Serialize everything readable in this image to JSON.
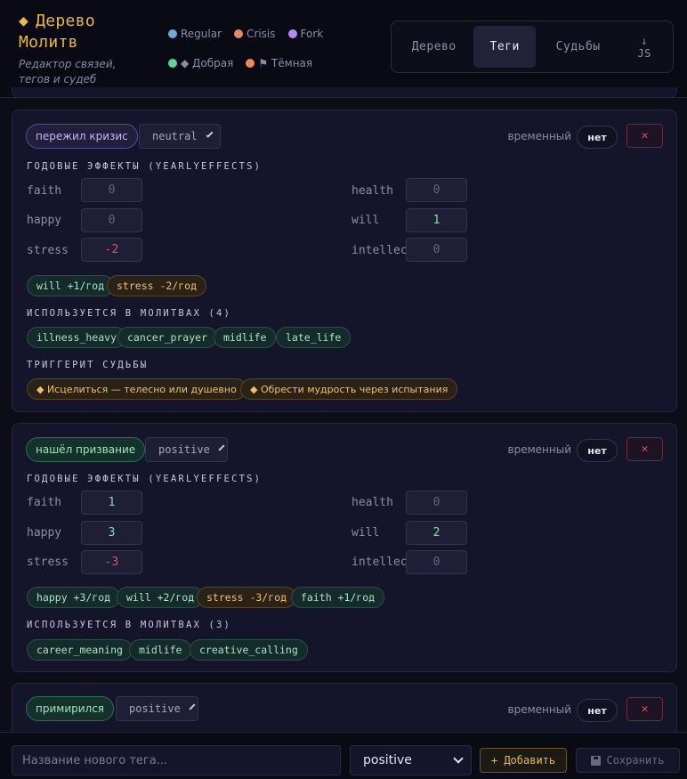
{
  "header": {
    "title_line1": "Дерево",
    "title_line2": "Молитв",
    "subtitle_line1": "Редактор связей,",
    "subtitle_line2": "тегов и судеб",
    "legend": [
      {
        "label": "Regular",
        "color": "#6fa8dc"
      },
      {
        "label": "Crisis",
        "color": "#e8856a"
      },
      {
        "label": "Fork",
        "color": "#b48cf0"
      },
      {
        "label": "◆ Добрая",
        "color": "#5fd49a"
      },
      {
        "label": "⚑ Тёмная",
        "color": "#f08a5d"
      }
    ],
    "tabs": [
      "Дерево",
      "Теги",
      "Судьбы"
    ],
    "active_tab": "Теги",
    "export_arrow": "↓",
    "export_label": "JS"
  },
  "cards": [
    {
      "tag": "пережил кризис",
      "kind": "neutral",
      "temp_label": "временный",
      "temp_value": "нет",
      "delete_label": "✕",
      "effects_title": "ГОДОВЫЕ ЭФФЕКТЫ (YEARLYEFFECTS)",
      "effects": {
        "faith": "0",
        "happy": "0",
        "stress": "-2",
        "health": "0",
        "will": "1",
        "intellect": "0"
      },
      "effect_chips": [
        "will +1/год",
        "stress -2/год"
      ],
      "prayers_title": "ИСПОЛЬЗУЕТСЯ В МОЛИТВАХ (4)",
      "prayers": [
        "illness_heavy",
        "cancer_prayer",
        "midlife",
        "late_life"
      ],
      "fates_title": "ТРИГГЕРИТ СУДЬБЫ",
      "fates": [
        "◆ Исцелиться — телесно или душевно",
        "◆ Обрести мудрость через испытания"
      ]
    },
    {
      "tag": "нашёл призвание",
      "kind": "positive",
      "temp_label": "временный",
      "temp_value": "нет",
      "delete_label": "✕",
      "effects_title": "ГОДОВЫЕ ЭФФЕКТЫ (YEARLYEFFECTS)",
      "effects": {
        "faith": "1",
        "happy": "3",
        "stress": "-3",
        "health": "0",
        "will": "2",
        "intellect": "0"
      },
      "effect_chips": [
        "happy +3/год",
        "will +2/год",
        "stress -3/год",
        "faith +1/год"
      ],
      "prayers_title": "ИСПОЛЬЗУЕТСЯ В МОЛИТВАХ (3)",
      "prayers": [
        "career_meaning",
        "midlife",
        "creative_calling"
      ]
    },
    {
      "tag": "примирился",
      "kind": "positive",
      "temp_label": "временный",
      "temp_value": "нет",
      "delete_label": "✕"
    }
  ],
  "effect_labels": {
    "faith": "faith",
    "happy": "happy",
    "stress": "stress",
    "health": "health",
    "will": "will",
    "intellect": "intellect"
  },
  "footer": {
    "new_tag_placeholder": "Название нового тега...",
    "kind_value": "positive",
    "add_label": "+ Добавить",
    "save_label": "Сохранить"
  }
}
